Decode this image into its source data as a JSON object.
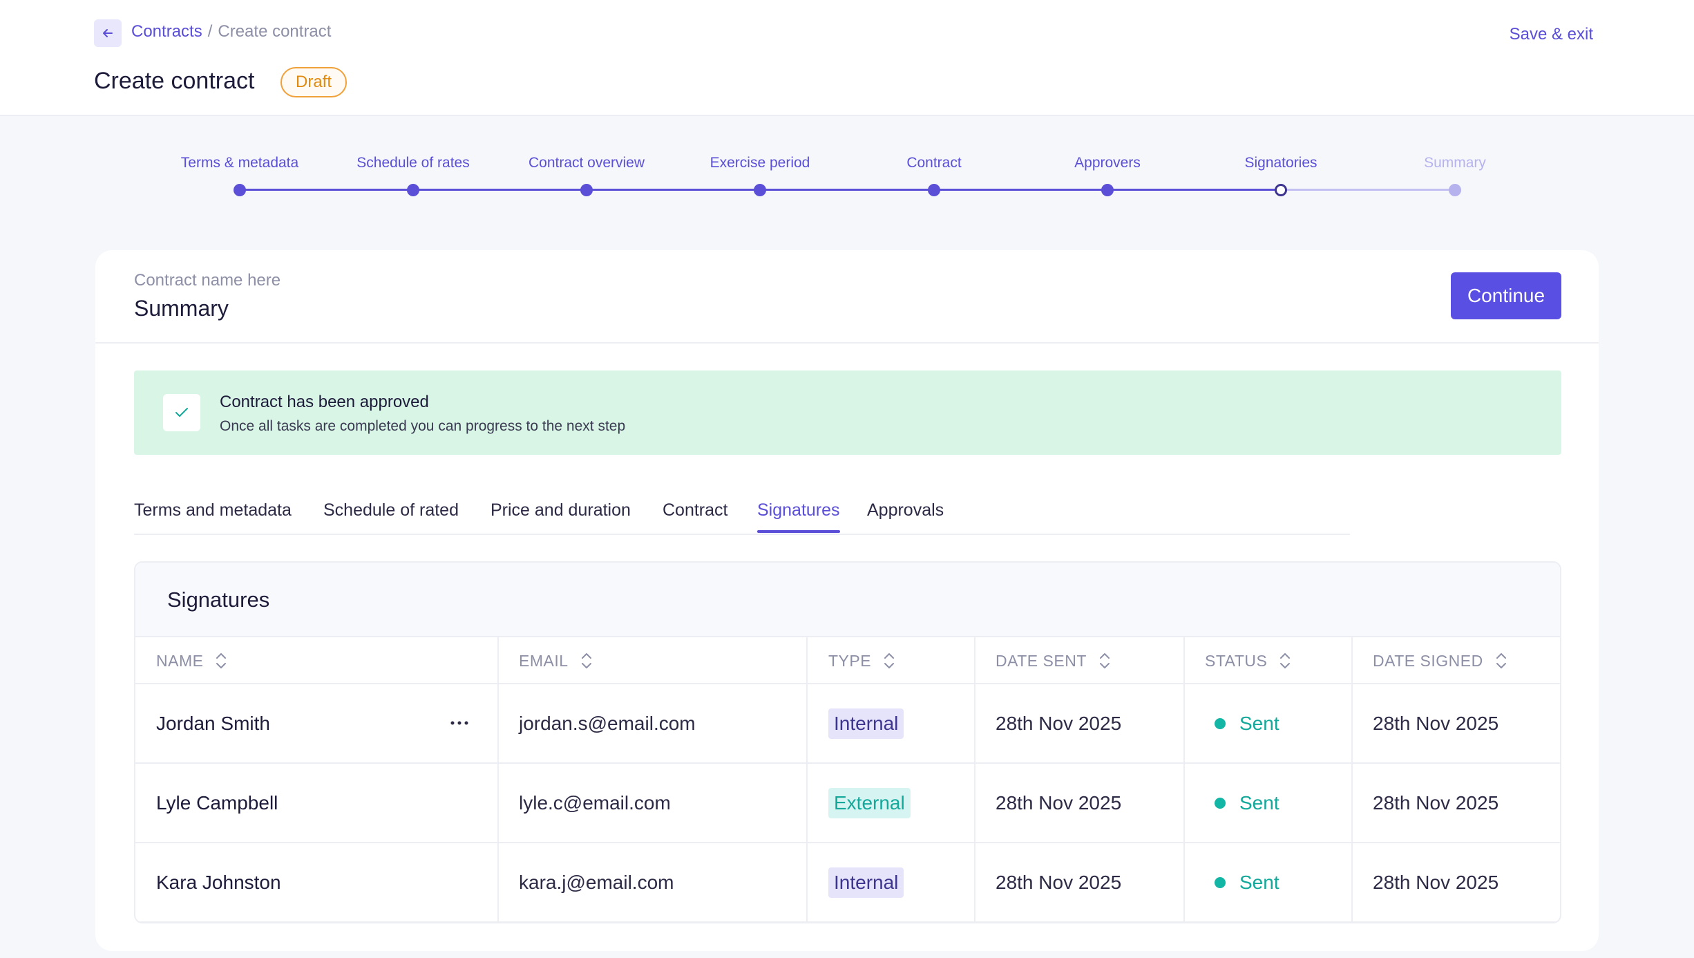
{
  "header": {
    "breadcrumb_link": "Contracts",
    "breadcrumb_separator": "/",
    "breadcrumb_current": "Create contract",
    "title": "Create contract",
    "status_badge": "Draft",
    "save_exit": "Save & exit"
  },
  "stepper": {
    "steps": [
      {
        "label": "Terms & metadata",
        "state": "done"
      },
      {
        "label": "Schedule of rates",
        "state": "done"
      },
      {
        "label": "Contract overview",
        "state": "done"
      },
      {
        "label": "Exercise period",
        "state": "done"
      },
      {
        "label": "Contract",
        "state": "done"
      },
      {
        "label": "Approvers",
        "state": "done"
      },
      {
        "label": "Signatories",
        "state": "current"
      },
      {
        "label": "Summary",
        "state": "future"
      }
    ]
  },
  "card": {
    "subtitle": "Contract name here",
    "title": "Summary",
    "continue_label": "Continue"
  },
  "alert": {
    "title": "Contract has been approved",
    "text": "Once all tasks are completed you can progress to the next step"
  },
  "tabs": [
    {
      "label": "Terms and metadata",
      "active": false
    },
    {
      "label": "Schedule of rated",
      "active": false
    },
    {
      "label": "Price and duration",
      "active": false
    },
    {
      "label": "Contract",
      "active": false
    },
    {
      "label": "Signatures",
      "active": true
    },
    {
      "label": "Approvals",
      "active": false
    }
  ],
  "signatures": {
    "title": "Signatures",
    "columns": [
      "NAME",
      "EMAIL",
      "TYPE",
      "DATE SENT",
      "STATUS",
      "DATE SIGNED"
    ],
    "rows": [
      {
        "name": "Jordan Smith",
        "email": "jordan.s@email.com",
        "type": "Internal",
        "date_sent": "28th Nov 2025",
        "status": "Sent",
        "date_signed": "28th Nov 2025"
      },
      {
        "name": "Lyle Campbell",
        "email": "lyle.c@email.com",
        "type": "External",
        "date_sent": "28th Nov 2025",
        "status": "Sent",
        "date_signed": "28th Nov 2025"
      },
      {
        "name": "Kara Johnston",
        "email": "kara.j@email.com",
        "type": "Internal",
        "date_sent": "28th Nov 2025",
        "status": "Sent",
        "date_signed": "28th Nov 2025"
      }
    ]
  },
  "colors": {
    "accent": "#5a4fd6",
    "success_bg": "#d9f5e6",
    "draft": "#e08a12",
    "status_sent": "#13a89a"
  }
}
